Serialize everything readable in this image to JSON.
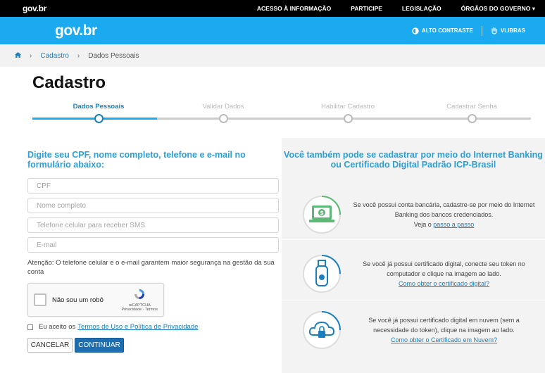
{
  "topbar": {
    "logo": "gov.br",
    "links": [
      "ACESSO À INFORMAÇÃO",
      "PARTICIPE",
      "LEGISLAÇÃO",
      "ÓRGÃOS DO GOVERNO ▾"
    ]
  },
  "header": {
    "brand": "gov.br",
    "contrast_label": "ALTO CONTRASTE",
    "vlibras_label": "VLIBRAS"
  },
  "breadcrumb": {
    "items": [
      "Cadastro",
      "Dados Pessoais"
    ]
  },
  "page_title": "Cadastro",
  "steps": [
    {
      "label": "Dados Pessoais",
      "active": true
    },
    {
      "label": "Validar Dados",
      "active": false
    },
    {
      "label": "Habilitar Cadastro",
      "active": false
    },
    {
      "label": "Cadastrar Senha",
      "active": false
    }
  ],
  "form": {
    "heading": "Digite seu CPF, nome completo, telefone e e-mail no formulário abaixo:",
    "fields": {
      "cpf": {
        "placeholder": "CPF",
        "value": ""
      },
      "name": {
        "placeholder": "Nome completo",
        "value": ""
      },
      "phone": {
        "placeholder": "Telefone celular para receber SMS",
        "value": ""
      },
      "email": {
        "placeholder": "E-mail",
        "value": ""
      }
    },
    "attention_label": "Atenção:",
    "attention_text": " O telefone celular e o e-mail garantem maior segurança na gestão da sua conta",
    "captcha": {
      "label": "Não sou um robô",
      "brand": "reCAPTCHA",
      "links": "Privacidade - Termos"
    },
    "terms_prefix": "Eu aceito os",
    "terms_link": "Termos de Uso e Política de Privacidade",
    "cancel_label": "CANCELAR",
    "continue_label": "CONTINUAR"
  },
  "alt": {
    "heading": "Você também pode se cadastrar por meio do Internet Banking ou Certificado Digital Padrão ICP-Brasil",
    "cards": [
      {
        "icon": "bank-laptop-icon",
        "text": "Se você possui conta bancária, cadastre-se por meio do Internet Banking dos bancos credenciados.",
        "link_prefix": "Veja o ",
        "link": "passo a passo"
      },
      {
        "icon": "usb-token-icon",
        "text": "Se você já possui certificado digital, conecte seu token no computador e clique na imagem ao lado.",
        "link_prefix": "",
        "link": "Como obter o certificado digital?"
      },
      {
        "icon": "cloud-lock-icon",
        "text": "Se você já possui certificado digital em nuvem (sem a necessidade do token), clique na imagem ao lado.",
        "link_prefix": "",
        "link": "Como obter o Certificado em Nuvem?"
      }
    ]
  },
  "colors": {
    "header_blue": "#1ba9ef",
    "link_blue": "#1a7fbf",
    "button_blue": "#1d6fb2",
    "icon_green": "#5cb874"
  }
}
